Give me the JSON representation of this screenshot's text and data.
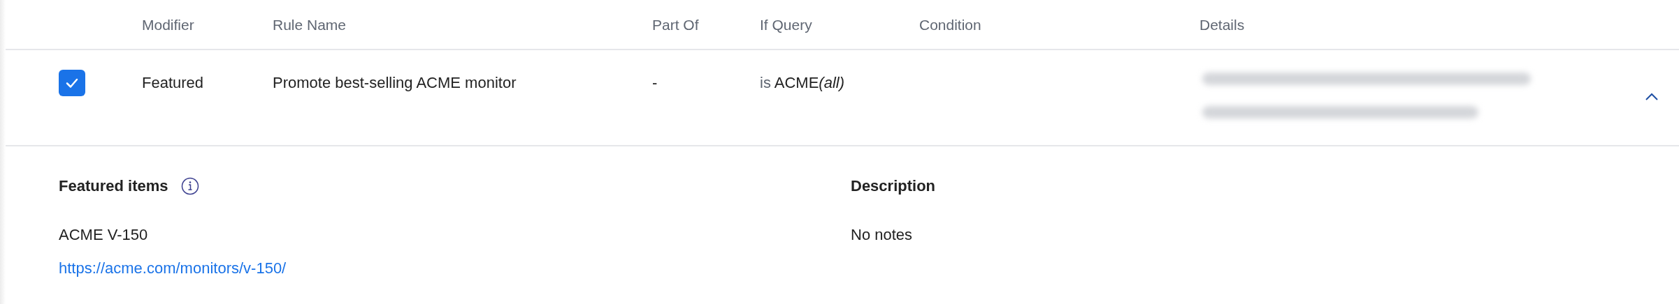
{
  "table": {
    "columns": [
      "Modifier",
      "Rule Name",
      "Part Of",
      "If Query",
      "Condition",
      "Details"
    ],
    "rows": [
      {
        "selected": true,
        "expanded": true,
        "modifier": "Featured",
        "rule_name": "Promote best-selling ACME monitor",
        "part_of": "-",
        "if_query": {
          "operator": "is",
          "value": "ACME",
          "scope": "(all)"
        }
      }
    ]
  },
  "detail": {
    "featured_title": "Featured items",
    "item_name": "ACME V-150",
    "item_url": "https://acme.com/monitors/v-150/",
    "description_title": "Description",
    "description": "No notes"
  }
}
